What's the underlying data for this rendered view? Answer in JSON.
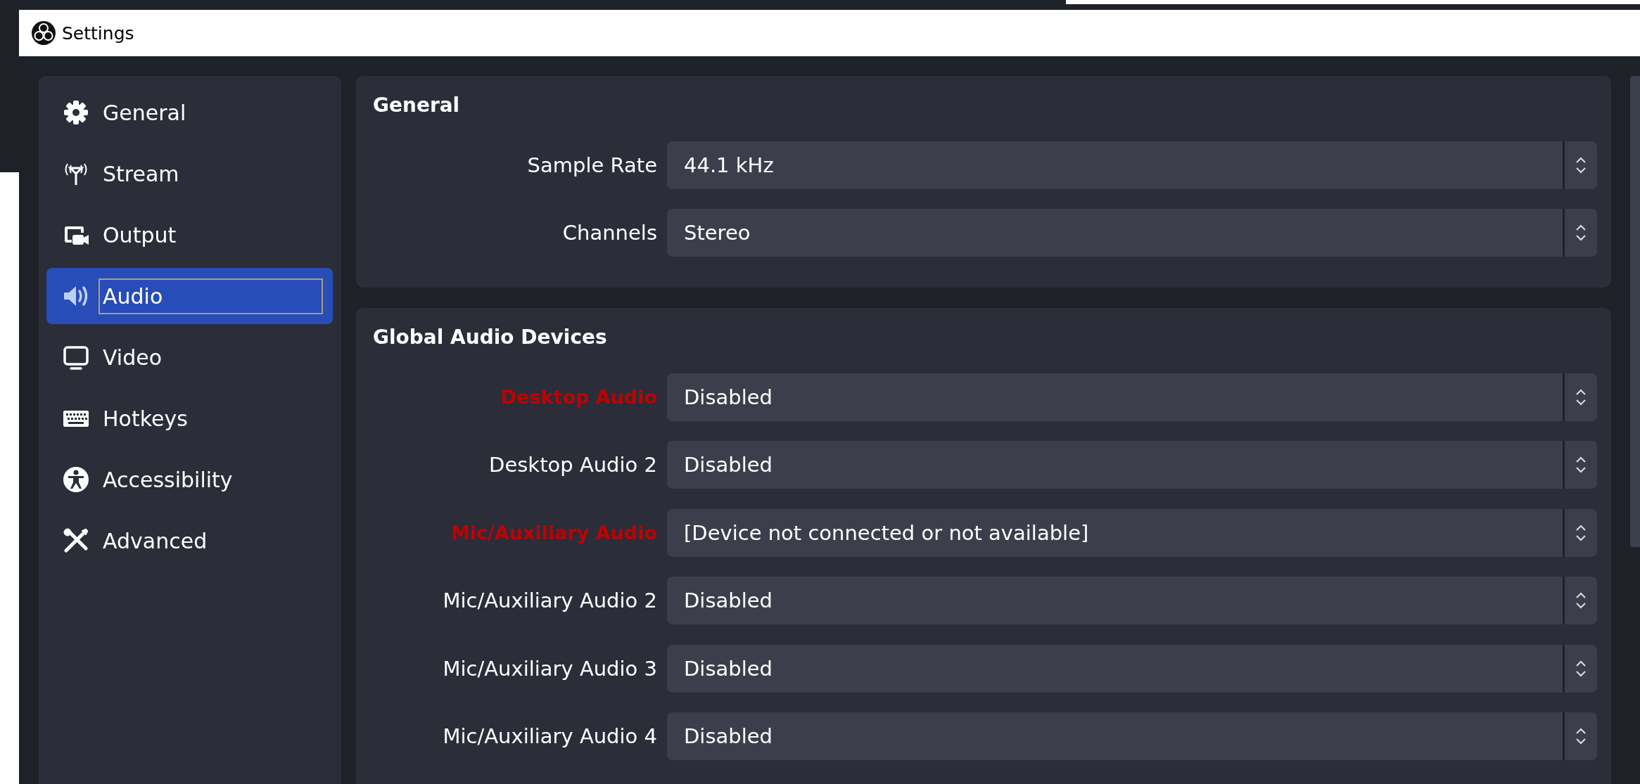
{
  "window": {
    "title": "Settings"
  },
  "sidebar": {
    "items": [
      {
        "label": "General",
        "selected": false
      },
      {
        "label": "Stream",
        "selected": false
      },
      {
        "label": "Output",
        "selected": false
      },
      {
        "label": "Audio",
        "selected": true
      },
      {
        "label": "Video",
        "selected": false
      },
      {
        "label": "Hotkeys",
        "selected": false
      },
      {
        "label": "Accessibility",
        "selected": false
      },
      {
        "label": "Advanced",
        "selected": false
      }
    ]
  },
  "sections": [
    {
      "title": "General",
      "rows": [
        {
          "label": "Sample Rate",
          "value": "44.1 kHz",
          "warning": false
        },
        {
          "label": "Channels",
          "value": "Stereo",
          "warning": false
        }
      ]
    },
    {
      "title": "Global Audio Devices",
      "rows": [
        {
          "label": "Desktop Audio",
          "value": "Disabled",
          "warning": true
        },
        {
          "label": "Desktop Audio 2",
          "value": "Disabled",
          "warning": false
        },
        {
          "label": "Mic/Auxiliary Audio",
          "value": "[Device not connected or not available]",
          "warning": true
        },
        {
          "label": "Mic/Auxiliary Audio 2",
          "value": "Disabled",
          "warning": false
        },
        {
          "label": "Mic/Auxiliary Audio 3",
          "value": "Disabled",
          "warning": false
        },
        {
          "label": "Mic/Auxiliary Audio 4",
          "value": "Disabled",
          "warning": false
        }
      ]
    }
  ]
}
